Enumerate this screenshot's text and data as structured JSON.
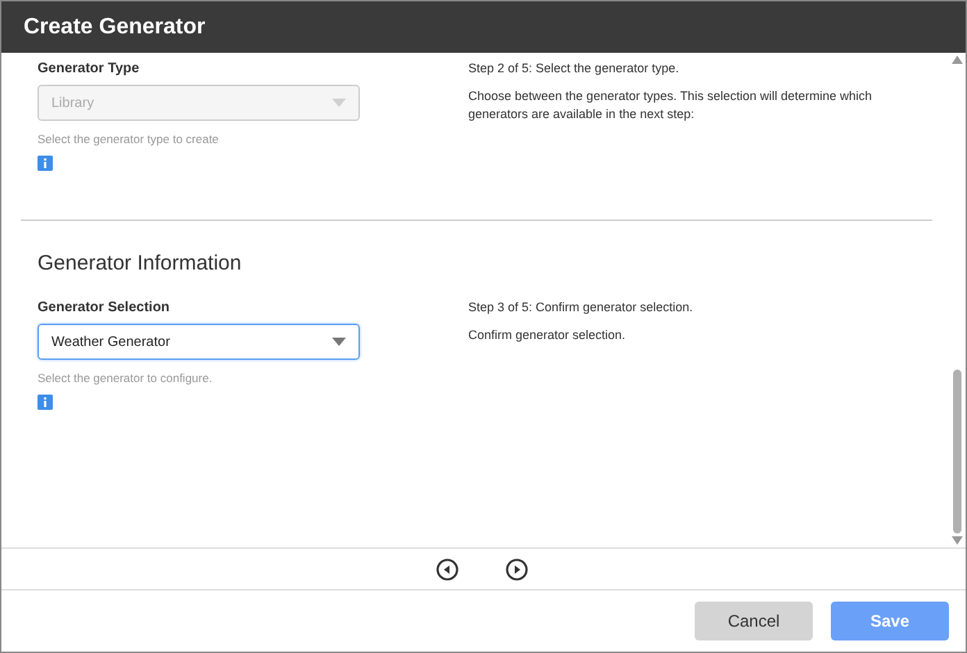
{
  "window": {
    "title": "Create Generator"
  },
  "sections": [
    {
      "field": {
        "label": "Generator Type",
        "value": "Library",
        "disabled": true,
        "focused": false,
        "help": "Select the generator type to create"
      },
      "step": "Step 2 of 5: Select the generator type.",
      "description": "Choose between the generator types. This selection will determine which generators are available in the next step:"
    },
    {
      "heading": "Generator Information",
      "field": {
        "label": "Generator Selection",
        "value": "Weather Generator",
        "disabled": false,
        "focused": true,
        "help": "Select the generator to configure."
      },
      "step": "Step 3 of 5: Confirm generator selection.",
      "description": "Confirm generator selection."
    }
  ],
  "buttons": [
    {
      "label": "Cancel",
      "kind": "secondary"
    },
    {
      "label": "Save",
      "kind": "primary"
    }
  ]
}
